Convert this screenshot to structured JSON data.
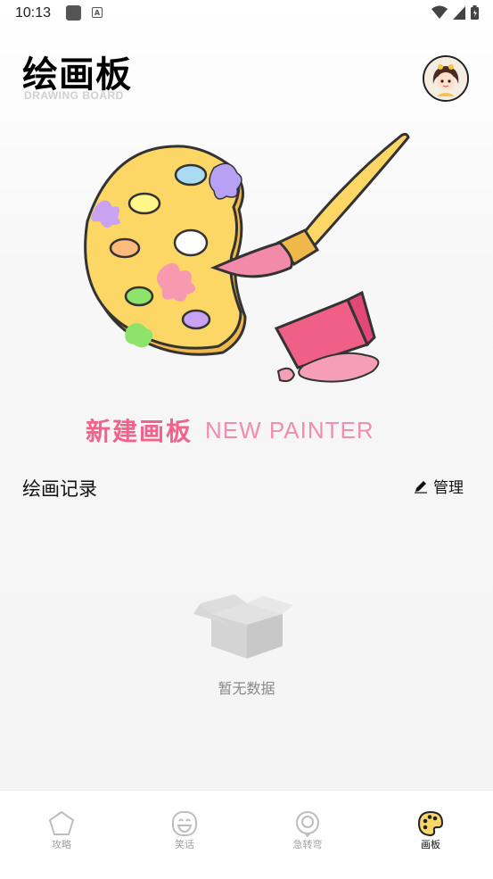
{
  "status_bar": {
    "time": "10:13"
  },
  "header": {
    "title": "绘画板",
    "subtitle": "DRAWING BOARD"
  },
  "new_painter": {
    "label_cn": "新建画板",
    "label_en": "NEW PAINTER"
  },
  "records": {
    "title": "绘画记录",
    "manage_label": "管理"
  },
  "empty_state": {
    "text": "暂无数据"
  },
  "tab_bar": {
    "tabs": [
      {
        "label": "攻略",
        "icon": "pentagon-icon",
        "active": false
      },
      {
        "label": "笑话",
        "icon": "smile-face-icon",
        "active": false
      },
      {
        "label": "急转弯",
        "icon": "chat-bubble-icon",
        "active": false
      },
      {
        "label": "画板",
        "icon": "palette-icon",
        "active": true
      }
    ]
  },
  "colors": {
    "accent_pink": "#f2628c",
    "palette_yellow": "#fcd766"
  }
}
